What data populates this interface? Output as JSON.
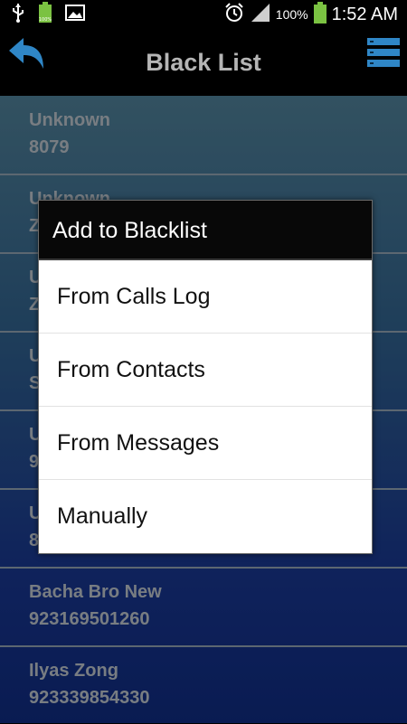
{
  "status_bar": {
    "battery_percent": "100%",
    "time": "1:52 AM",
    "icons": [
      "usb-icon",
      "battery-full-small-icon",
      "image-icon",
      "alarm-icon",
      "signal-icon",
      "battery-icon"
    ]
  },
  "action_bar": {
    "title": "Black List",
    "back_icon": "back-arrow-icon",
    "menu_icon": "menu-list-icon"
  },
  "list": {
    "items": [
      {
        "name": "Unknown",
        "number": "8079"
      },
      {
        "name": "Unknown",
        "number": "Z"
      },
      {
        "name": "U",
        "number": "Z"
      },
      {
        "name": "U",
        "number": "S"
      },
      {
        "name": "U",
        "number": "9"
      },
      {
        "name": "U",
        "number": "8"
      },
      {
        "name": "Bacha Bro New",
        "number": "923169501260"
      },
      {
        "name": "Ilyas Zong",
        "number": "923339854330"
      }
    ]
  },
  "dialog": {
    "title": "Add to Blacklist",
    "options": [
      "From Calls Log",
      "From Contacts",
      "From Messages",
      "Manually"
    ]
  },
  "colors": {
    "accent_blue": "#2f86c6",
    "list_text": "#b9c0c8",
    "title_text": "#b5b5b5"
  }
}
